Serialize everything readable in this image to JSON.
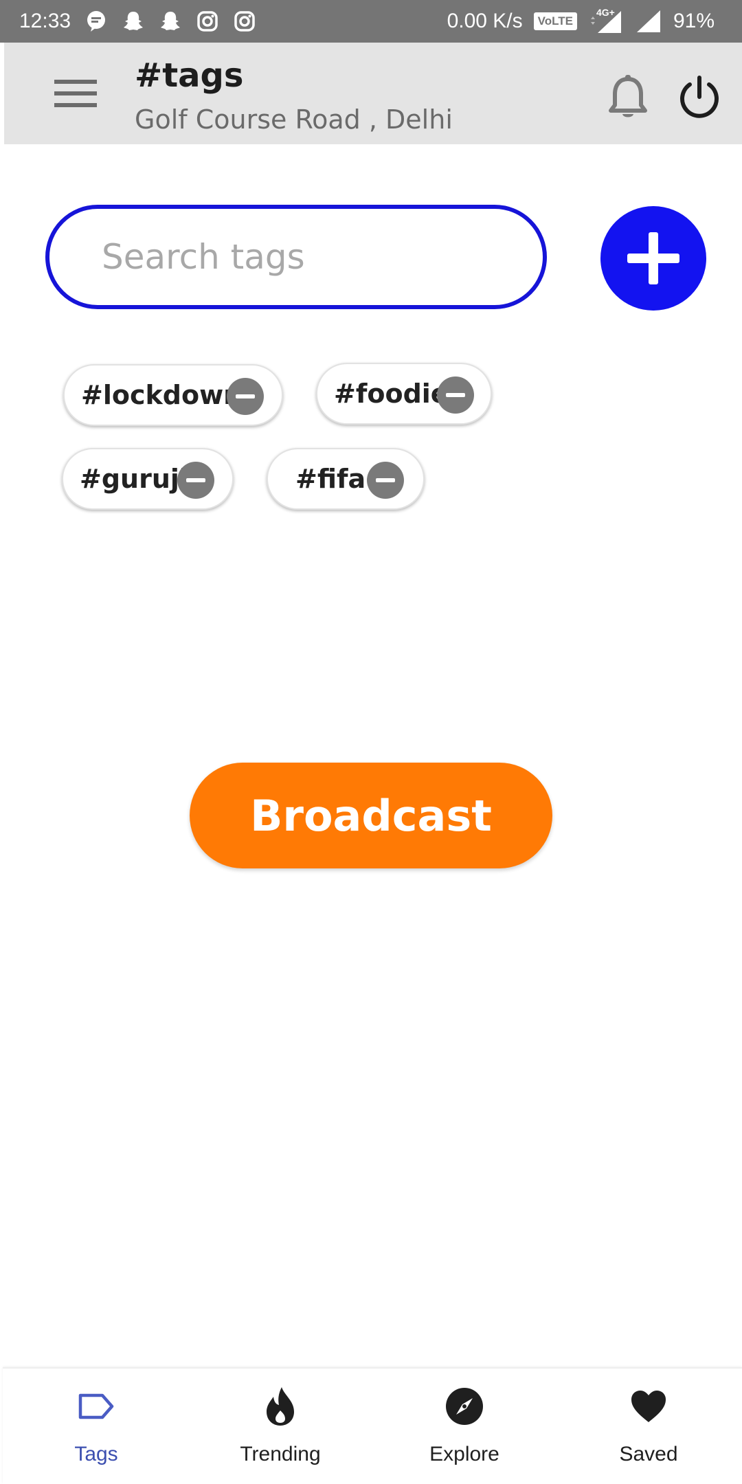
{
  "status_bar": {
    "time": "12:33",
    "net_speed": "0.00 K/s",
    "volte": "VoLTE",
    "network": "4G+",
    "battery": "91%",
    "notification_icons": [
      "chat-bubble-icon",
      "snapchat-icon",
      "snapchat-icon",
      "instagram-icon",
      "instagram-icon"
    ]
  },
  "app_bar": {
    "title": "#tags",
    "subtitle": "Golf Course Road , Delhi",
    "icons": [
      "menu-icon",
      "bell-icon",
      "power-icon"
    ]
  },
  "search": {
    "placeholder": "Search tags",
    "value": ""
  },
  "tags": [
    {
      "label": "#lockdown"
    },
    {
      "label": "#foodie"
    },
    {
      "label": "#guruji"
    },
    {
      "label": "#fifa"
    }
  ],
  "broadcast_label": "Broadcast",
  "bottom_nav": [
    {
      "label": "Tags",
      "icon": "tag-icon",
      "active": true
    },
    {
      "label": "Trending",
      "icon": "flame-icon",
      "active": false
    },
    {
      "label": "Explore",
      "icon": "compass-icon",
      "active": false
    },
    {
      "label": "Saved",
      "icon": "heart-icon",
      "active": false
    }
  ],
  "colors": {
    "accent_blue": "#1313f0",
    "search_border": "#1614d8",
    "broadcast_orange": "#ff7a05",
    "active_nav": "#3c4fb0",
    "status_bar": "#757575",
    "app_bar": "#e4e4e4"
  }
}
